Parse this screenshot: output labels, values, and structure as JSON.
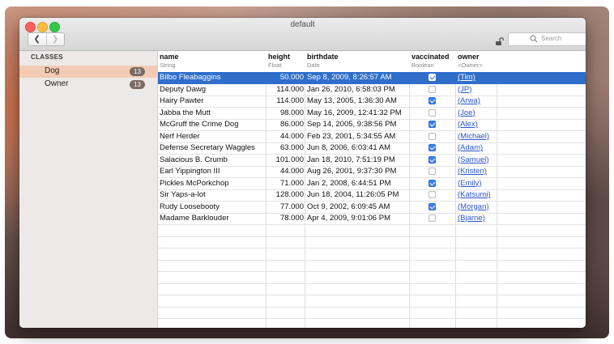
{
  "window": {
    "title": "default"
  },
  "toolbar": {
    "back_icon": "chevron-left-icon",
    "forward_icon": "chevron-right-icon",
    "lock_icon": "unlocked-padlock-icon",
    "search_placeholder": "Search"
  },
  "sidebar": {
    "header": "CLASSES",
    "items": [
      {
        "label": "Dog",
        "count": "13",
        "selected": true
      },
      {
        "label": "Owner",
        "count": "13",
        "selected": false
      }
    ]
  },
  "table": {
    "columns": [
      {
        "name": "name",
        "type": "String"
      },
      {
        "name": "height",
        "type": "Float"
      },
      {
        "name": "birthdate",
        "type": "Date"
      },
      {
        "name": "vaccinated",
        "type": "Boolean"
      },
      {
        "name": "owner",
        "type": "<Owner>"
      }
    ],
    "rows": [
      {
        "name": "Bilbo Fleabaggins",
        "height": "50.000",
        "birthdate": "Sep 8, 2009, 8:26:57 AM",
        "vaccinated": true,
        "owner": "(Tim)",
        "selected": true
      },
      {
        "name": "Deputy Dawg",
        "height": "114.000",
        "birthdate": "Jan 26, 2010, 6:58:03 PM",
        "vaccinated": false,
        "owner": "(JP)"
      },
      {
        "name": "Hairy Pawter",
        "height": "114.000",
        "birthdate": "May 13, 2005, 1:36:30 AM",
        "vaccinated": true,
        "owner": "(Arwa)"
      },
      {
        "name": "Jabba the Mutt",
        "height": "98.000",
        "birthdate": "May 16, 2009, 12:41:32 PM",
        "vaccinated": false,
        "owner": "(Joe)"
      },
      {
        "name": "McGruff the Crime Dog",
        "height": "86.000",
        "birthdate": "Sep 14, 2005, 9:38:56 PM",
        "vaccinated": true,
        "owner": "(Alex)"
      },
      {
        "name": "Nerf Herder",
        "height": "44.000",
        "birthdate": "Feb 23, 2001, 5:34:55 AM",
        "vaccinated": false,
        "owner": "(Michael)"
      },
      {
        "name": "Defense Secretary Waggles",
        "height": "63.000",
        "birthdate": "Jun 8, 2006, 6:03:41 AM",
        "vaccinated": true,
        "owner": "(Adam)"
      },
      {
        "name": "Salacious B. Crumb",
        "height": "101.000",
        "birthdate": "Jan 18, 2010, 7:51:19 PM",
        "vaccinated": true,
        "owner": "(Samuel)"
      },
      {
        "name": "Earl Yippington III",
        "height": "44.000",
        "birthdate": "Aug 26, 2001, 9:37:30 PM",
        "vaccinated": false,
        "owner": "(Kristen)"
      },
      {
        "name": "Pickles McPorkchop",
        "height": "71.000",
        "birthdate": "Jan 2, 2008, 6:44:51 PM",
        "vaccinated": true,
        "owner": "(Emily)"
      },
      {
        "name": "Sir Yaps-a-lot",
        "height": "128.000",
        "birthdate": "Jun 18, 2004, 11:26:05 PM",
        "vaccinated": false,
        "owner": "(Katsumi)"
      },
      {
        "name": "Rudy Loosebooty",
        "height": "77.000",
        "birthdate": "Oct 9, 2002, 6:09:45 AM",
        "vaccinated": true,
        "owner": "(Morgan)"
      },
      {
        "name": "Madame Barklouder",
        "height": "78.000",
        "birthdate": "Apr 4, 2009, 9:01:06 PM",
        "vaccinated": false,
        "owner": "(Bjarne)"
      }
    ]
  },
  "colors": {
    "selection": "#2f6ecb",
    "sidebar_selection": "#f3cbb4",
    "link": "#2a55c8"
  }
}
